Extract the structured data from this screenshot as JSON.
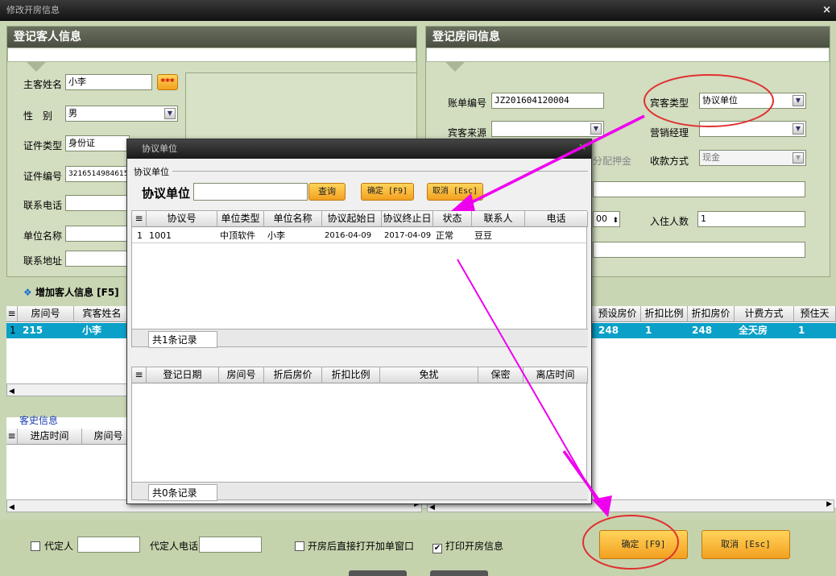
{
  "window": {
    "title": "修改开房信息",
    "close": "×"
  },
  "guest_panel": {
    "title": "登记客人信息",
    "main_name_label": "主客姓名",
    "main_name_value": "小李",
    "more_btn": "***",
    "gender_label": "性　别",
    "gender_value": "男",
    "id_type_label": "证件类型",
    "id_type_value": "身份证",
    "id_no_label": "证件编号",
    "id_no_value": "3216514984615",
    "phone_label": "联系电话",
    "unit_label": "单位名称",
    "address_label": "联系地址",
    "add_guest": "增加客人信息 [F5]"
  },
  "room_panel": {
    "title": "登记房间信息",
    "bill_no_label": "账单编号",
    "bill_no_value": "JZ201604120004",
    "guest_type_label": "宾客类型",
    "guest_type_value": "协议单位",
    "source_label": "宾客来源",
    "sales_label": "营销经理",
    "deposit_label": "分配押金",
    "pay_label": "收款方式",
    "pay_value": "现金",
    "time_value": "00",
    "people_label": "入住人数",
    "people_value": "1"
  },
  "room_grid": {
    "left_headers": [
      "房间号",
      "宾客姓名"
    ],
    "right_headers": [
      "预设房价",
      "折扣比例",
      "折扣房价",
      "计费方式",
      "预住天"
    ],
    "row": {
      "num": "1",
      "room": "215",
      "name": "小李",
      "price": "248",
      "ratio": "1",
      "disc": "248",
      "mode": "全天房",
      "days": "1"
    }
  },
  "history": {
    "title": "客史信息",
    "headers": [
      "进店时间",
      "房间号"
    ]
  },
  "dialog": {
    "title": "协议单位",
    "close": "×",
    "group_label": "协议单位",
    "search_label": "协议单位",
    "query_btn": "查询",
    "ok_btn": "确定 [F9]",
    "cancel_btn": "取消 [Esc]",
    "headers": [
      "协议号",
      "单位类型",
      "单位名称",
      "协议起始日",
      "协议终止日",
      "状态",
      "联系人",
      "电话"
    ],
    "rows": [
      {
        "num": "1",
        "id": "1001",
        "type": "中顶软件",
        "name": "小李",
        "start": "2016-04-09",
        "end": "2017-04-09",
        "status": "正常",
        "contact": "豆豆",
        "phone": ""
      }
    ],
    "count1": "共1条记录",
    "headers2": [
      "登记日期",
      "房间号",
      "折后房价",
      "折扣比例",
      "免扰",
      "保密",
      "离店时间"
    ],
    "count2": "共0条记录"
  },
  "footer": {
    "proxy_label": "代定人",
    "proxy_phone_label": "代定人电话",
    "open_bill_label": "开房后直接打开加单窗口",
    "print_label": "打印开房信息",
    "ok_btn": "确定 [F9]",
    "cancel_btn": "取消 [Esc]"
  },
  "colors": {
    "highlight_row": "#0aa0c8",
    "annotation": "#ee00ee",
    "circle": "#e03030"
  }
}
